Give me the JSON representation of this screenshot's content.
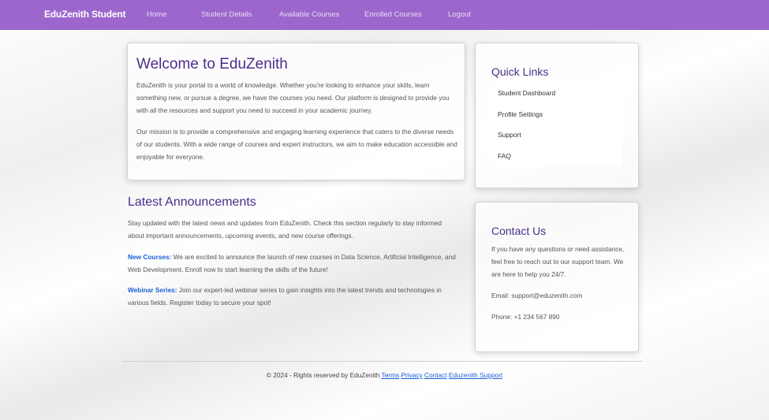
{
  "nav": {
    "brand": "EduZenith Student",
    "links": [
      "Home",
      "Student Details",
      "Available Courses",
      "Enrolled Courses",
      "Logout"
    ]
  },
  "welcome": {
    "title": "Welcome to EduZenith",
    "p1": "EduZenith is your portal to a world of knowledge. Whether you're looking to enhance your skills, learn something new, or pursue a degree, we have the courses you need. Our platform is designed to provide you with all the resources and support you need to succeed in your academic journey.",
    "p2": "Our mission is to provide a comprehensive and engaging learning experience that caters to the diverse needs of our students. With a wide range of courses and expert instructors, we aim to make education accessible and enjoyable for everyone."
  },
  "quick_links": {
    "title": "Quick Links",
    "items": [
      "Student Dashboard",
      "Profile Settings",
      "Support",
      "FAQ"
    ]
  },
  "announcements": {
    "title": "Latest Announcements",
    "intro": "Stay updated with the latest news and updates from EduZenith. Check this section regularly to stay informed about important announcements, upcoming events, and new course offerings.",
    "items": [
      {
        "label": "New Courses:",
        "text": " We are excited to announce the launch of new courses in Data Science, Artificial Intelligence, and Web Development. Enroll now to start learning the skills of the future!"
      },
      {
        "label": "Webinar Series:",
        "text": " Join our expert-led webinar series to gain insights into the latest trends and technologies in various fields. Register today to secure your spot!"
      }
    ]
  },
  "contact": {
    "title": "Contact Us",
    "text": "If you have any questions or need assistance, feel free to reach out to our support team. We are here to help you 24/7.",
    "email": "Email: support@eduzenith.com",
    "phone": "Phone: +1 234 567 890"
  },
  "footer": {
    "copyright": "© 2024 - Rights reserved by EduZenith ",
    "links": [
      "Terms",
      "Privacy",
      "Contact",
      "Eduzenith Support"
    ]
  }
}
